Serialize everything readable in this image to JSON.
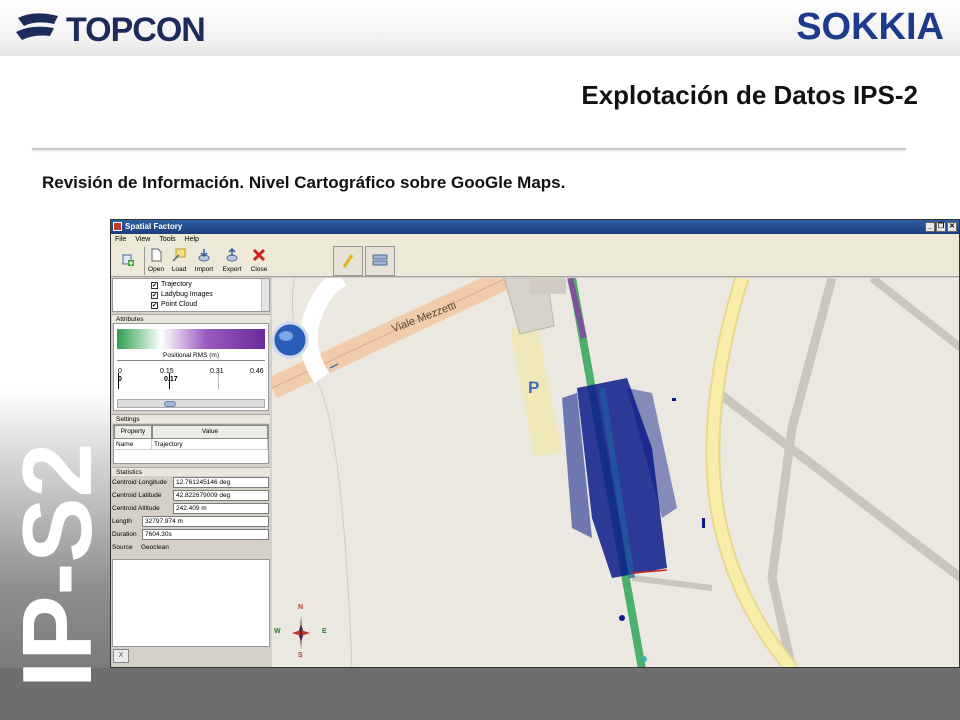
{
  "slide": {
    "brand_left": "TOPCON",
    "brand_right": "SOKKIA",
    "title": "Explotación de Datos IPS-2",
    "subtitle": "Revisión de Información. Nivel Cartográfico sobre GooGle Maps.",
    "vertical_label": "IP-S2"
  },
  "window": {
    "title": "Spatial Factory",
    "controls": [
      "_",
      "❐",
      "✕"
    ]
  },
  "menu": [
    "File",
    "View",
    "Tools",
    "Help"
  ],
  "toolbar": {
    "buttons": [
      {
        "label": "",
        "icon": "add-icon"
      },
      {
        "label": "Open",
        "icon": "open-file-icon"
      },
      {
        "label": "Load",
        "icon": "load-icon"
      },
      {
        "label": "Import",
        "icon": "import-icon"
      },
      {
        "label": "Export",
        "icon": "export-icon"
      },
      {
        "label": "Close",
        "icon": "close-icon"
      }
    ]
  },
  "layers": [
    {
      "label": "Trajectory",
      "checked": true
    },
    {
      "label": "Ladybug Images",
      "checked": true
    },
    {
      "label": "Point Cloud",
      "checked": true
    }
  ],
  "attributes": {
    "header": "Attributes",
    "rms_title": "Positional RMS (m)",
    "ticks": [
      "0",
      "0.15",
      "0.31",
      "0.46"
    ],
    "selected": [
      "0",
      "0.17"
    ],
    "colors": {
      "low": "#2e9f4f",
      "high": "#6b2a9a"
    }
  },
  "settings": {
    "header": "Settings",
    "columns": [
      "Property",
      "Value"
    ],
    "rows": [
      {
        "property": "Name",
        "value": "Trajectory"
      }
    ]
  },
  "statistics": {
    "header": "Statistics",
    "rows": [
      {
        "label": "Centroid Longitude",
        "value": "12.761245146 deg"
      },
      {
        "label": "Centroid Latitude",
        "value": "42.822679009 deg"
      },
      {
        "label": "Centroid Altitude",
        "value": "242.409 m"
      },
      {
        "label": "Length",
        "value": "32797.974 m"
      },
      {
        "label": "Duration",
        "value": "7604.30s"
      },
      {
        "label": "Source",
        "value": "Geoclean"
      }
    ]
  },
  "map": {
    "street_label": "Viale Mezzetti",
    "parking_label": "P",
    "compass": {
      "n": "N",
      "s": "S",
      "w": "W",
      "e": "E"
    },
    "colors": {
      "trajectory": "#4caf6a",
      "points": "#0a1a8a",
      "road_yellow": "#f5e79e",
      "road_orange": "#f2ccaa"
    }
  },
  "footer_button": "X"
}
